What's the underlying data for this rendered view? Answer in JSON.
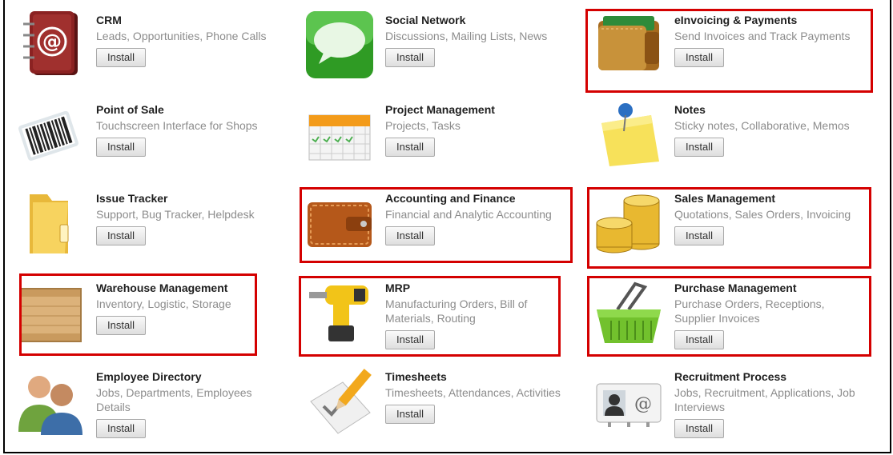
{
  "apps": [
    {
      "title": "CRM",
      "desc": "Leads, Opportunities, Phone Calls",
      "button": "Install",
      "icon": "address-book-icon"
    },
    {
      "title": "Social Network",
      "desc": "Discussions, Mailing Lists, News",
      "button": "Install",
      "icon": "chat-bubble-icon"
    },
    {
      "title": "eInvoicing & Payments",
      "desc": "Send Invoices and Track Payments",
      "button": "Install",
      "icon": "wallet-icon"
    },
    {
      "title": "Point of Sale",
      "desc": "Touchscreen Interface for Shops",
      "button": "Install",
      "icon": "barcode-scanner-icon"
    },
    {
      "title": "Project Management",
      "desc": "Projects, Tasks",
      "button": "Install",
      "icon": "calendar-icon"
    },
    {
      "title": "Notes",
      "desc": "Sticky notes, Collaborative, Memos",
      "button": "Install",
      "icon": "sticky-note-icon"
    },
    {
      "title": "Issue Tracker",
      "desc": "Support, Bug Tracker, Helpdesk",
      "button": "Install",
      "icon": "folder-icon"
    },
    {
      "title": "Accounting and Finance",
      "desc": "Financial and Analytic Accounting",
      "button": "Install",
      "icon": "wallet-closed-icon"
    },
    {
      "title": "Sales Management",
      "desc": "Quotations, Sales Orders, Invoicing",
      "button": "Install",
      "icon": "coins-icon"
    },
    {
      "title": "Warehouse Management",
      "desc": "Inventory, Logistic, Storage",
      "button": "Install",
      "icon": "wooden-crate-icon"
    },
    {
      "title": "MRP",
      "desc": "Manufacturing Orders, Bill of Materials, Routing",
      "button": "Install",
      "icon": "power-drill-icon"
    },
    {
      "title": "Purchase Management",
      "desc": "Purchase Orders, Receptions, Supplier Invoices",
      "button": "Install",
      "icon": "shopping-basket-icon"
    },
    {
      "title": "Employee Directory",
      "desc": "Jobs, Departments, Employees Details",
      "button": "Install",
      "icon": "people-icon"
    },
    {
      "title": "Timesheets",
      "desc": "Timesheets, Attendances, Activities",
      "button": "Install",
      "icon": "pencil-checklist-icon"
    },
    {
      "title": "Recruitment Process",
      "desc": "Jobs, Recruitment, Applications, Job Interviews",
      "button": "Install",
      "icon": "contact-card-icon"
    }
  ],
  "highlight_color": "#d40000"
}
